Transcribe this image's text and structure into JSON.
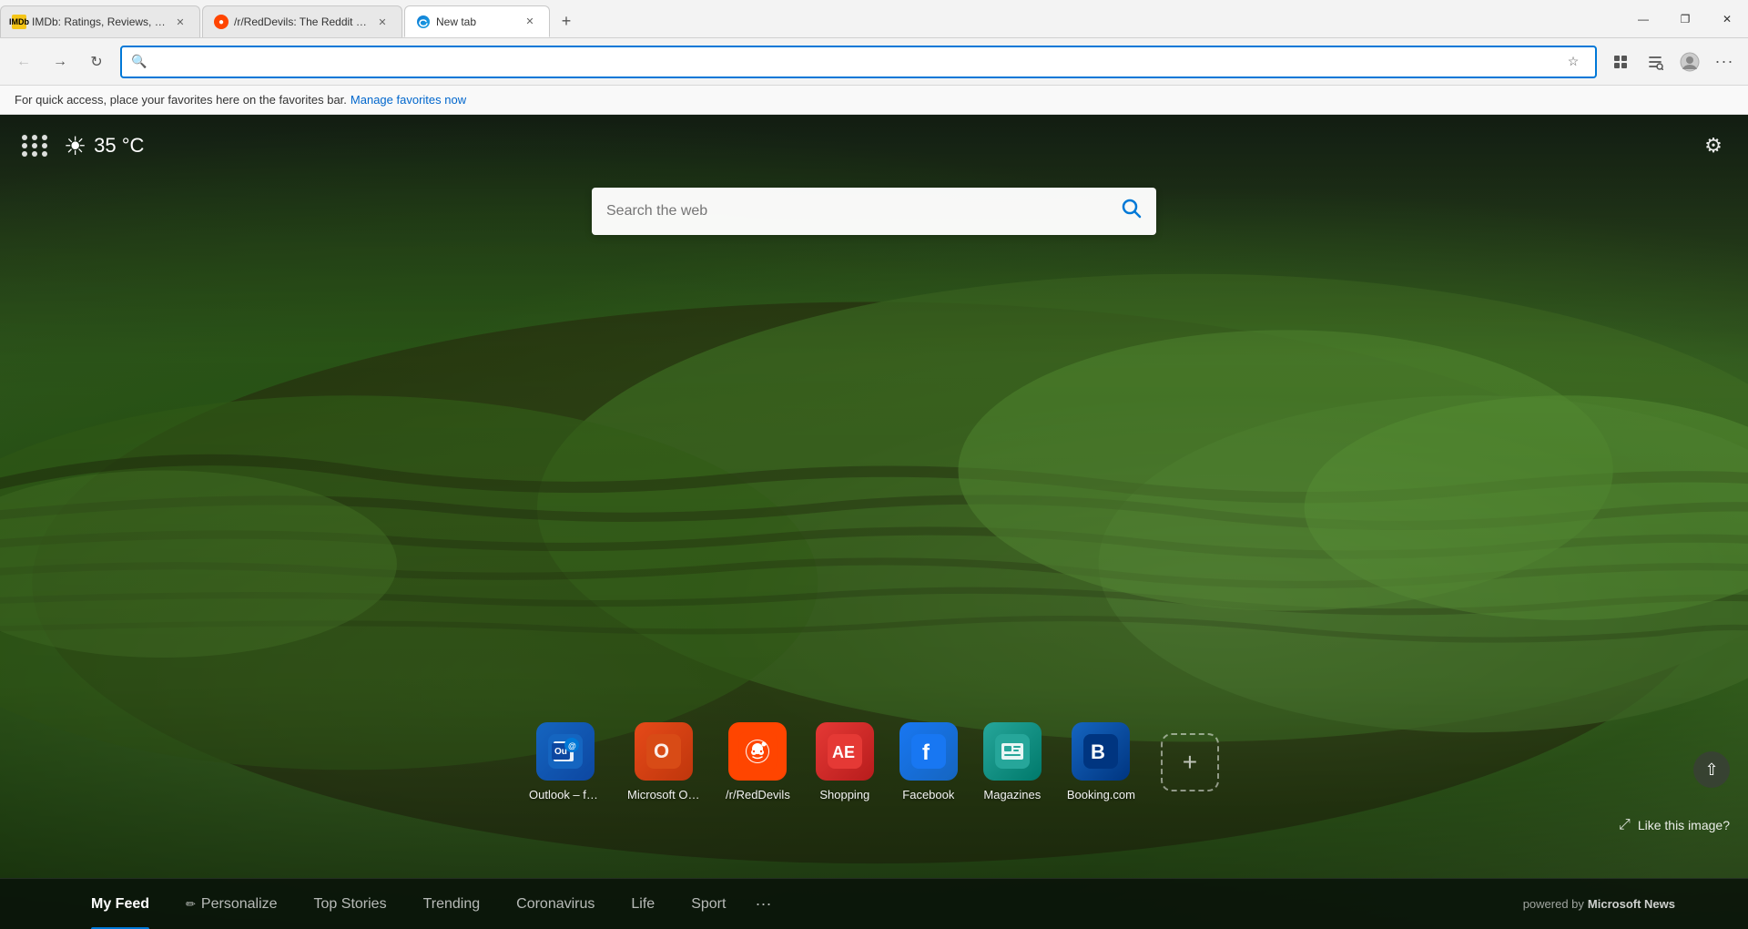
{
  "tabs": [
    {
      "id": "imdb",
      "title": "IMDb: Ratings, Reviews, and Wh",
      "active": false,
      "favicon_type": "imdb"
    },
    {
      "id": "reddit",
      "title": "/r/RedDevils: The Reddit home f",
      "active": false,
      "favicon_type": "reddit"
    },
    {
      "id": "newtab",
      "title": "New tab",
      "active": true,
      "favicon_type": "edge"
    }
  ],
  "window_controls": {
    "minimize": "—",
    "maximize": "❐",
    "close": "✕"
  },
  "nav": {
    "back_disabled": true,
    "forward_disabled": false,
    "address_value": "",
    "address_placeholder": ""
  },
  "favorites_bar": {
    "prompt": "For quick access, place your favorites here on the favorites bar.",
    "link_text": "Manage favorites now"
  },
  "new_tab": {
    "weather": {
      "temp": "35 °C"
    },
    "search_placeholder": "Search the web",
    "quick_links": [
      {
        "id": "outlook",
        "label": "Outlook – fre...",
        "icon_type": "outlook"
      },
      {
        "id": "office",
        "label": "Microsoft Offi...",
        "icon_type": "office"
      },
      {
        "id": "reddit",
        "label": "/r/RedDevils",
        "icon_type": "reddit"
      },
      {
        "id": "aliexpress",
        "label": "Shopping",
        "icon_type": "aliexpress"
      },
      {
        "id": "facebook",
        "label": "Facebook",
        "icon_type": "facebook"
      },
      {
        "id": "magazines",
        "label": "Magazines",
        "icon_type": "magazines"
      },
      {
        "id": "booking",
        "label": "Booking.com",
        "icon_type": "booking"
      }
    ],
    "like_image_text": "Like this image?",
    "bottom_tabs": [
      {
        "id": "myfeed",
        "label": "My Feed",
        "active": true
      },
      {
        "id": "personalize",
        "label": "Personalize",
        "active": false,
        "has_icon": true
      },
      {
        "id": "topstories",
        "label": "Top Stories",
        "active": false
      },
      {
        "id": "trending",
        "label": "Trending",
        "active": false
      },
      {
        "id": "coronavirus",
        "label": "Coronavirus",
        "active": false
      },
      {
        "id": "life",
        "label": "Life",
        "active": false
      },
      {
        "id": "sport",
        "label": "Sport",
        "active": false
      }
    ],
    "powered_by": "powered by",
    "news_brand": "Microsoft News"
  }
}
